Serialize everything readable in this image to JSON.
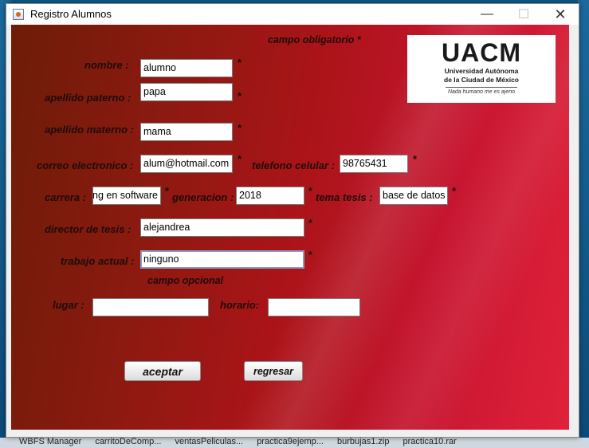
{
  "window": {
    "title": "Registro Alumnos"
  },
  "header": {
    "required_note": "campo obligatorio *"
  },
  "logo": {
    "acronym": "UACM",
    "line1": "Universidad Autónoma",
    "line2": "de la Ciudad de México",
    "motto": "Nada humano me es ajeno"
  },
  "form": {
    "nombre": {
      "label": "nombre :",
      "value": "alumno"
    },
    "apellido_paterno": {
      "label": "apellido paterno :",
      "value": "papa"
    },
    "apellido_materno": {
      "label": "apellido materno :",
      "value": "mama"
    },
    "correo": {
      "label": "correo electronico :",
      "value": "alum@hotmail.com"
    },
    "telefono": {
      "label": "telefono celular :",
      "value": "98765431"
    },
    "carrera": {
      "label": "carrera :",
      "value": "ing en software"
    },
    "generacion": {
      "label": "generacion :",
      "value": "2018"
    },
    "tema_tesis": {
      "label": "tema tesis :",
      "value": "base de datos"
    },
    "director": {
      "label": "director  de tesis :",
      "value": "alejandrea"
    },
    "trabajo_actual": {
      "label": "trabajo actual :",
      "value": "ninguno"
    },
    "optional_note": "campo opcional",
    "lugar": {
      "label": "lugar :",
      "value": ""
    },
    "horario": {
      "label": "horario:",
      "value": ""
    },
    "required_mark": "*"
  },
  "buttons": {
    "aceptar": "aceptar",
    "regresar": "regresar"
  },
  "taskbar": {
    "items": [
      "WBFS Manager",
      "carritoDeComp...",
      "ventasPeliculas...",
      "practica9ejemp...",
      "burbujas1.zip",
      "practica10.rar"
    ]
  },
  "controls": {
    "minimize": "—",
    "maximize": "☐",
    "close": "✕"
  }
}
